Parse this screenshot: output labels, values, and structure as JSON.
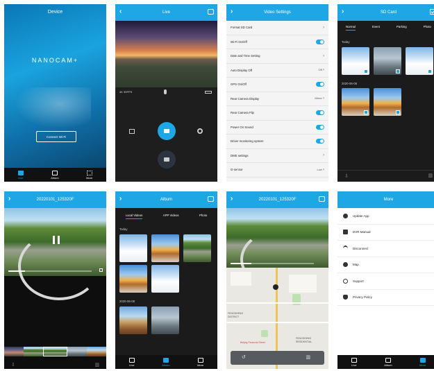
{
  "screens": {
    "device": {
      "title": "Device",
      "logo": "NANOCAM+",
      "connect_button": "Connect Wi-Fi",
      "tabs": [
        "Live",
        "Album",
        "More"
      ]
    },
    "live": {
      "title": "Live",
      "resolution": "4K 30FPS",
      "icons": [
        "back-icon",
        "mic-icon",
        "camera-icon",
        "gallery-icon",
        "video-record-icon",
        "settings-icon",
        "snapshot-icon"
      ]
    },
    "video_settings": {
      "title": "Video Settings",
      "rows": [
        {
          "label": "Format SD Card",
          "kind": "chevron",
          "value": ""
        },
        {
          "label": "Wi-Fi On/Off",
          "kind": "toggle",
          "value": ""
        },
        {
          "label": "Date and Time Setting",
          "kind": "chevron",
          "value": ""
        },
        {
          "label": "Auto Display Off",
          "kind": "value",
          "value": "Off"
        },
        {
          "label": "GPS On/Off",
          "kind": "toggle",
          "value": ""
        },
        {
          "label": "Rear Camera Display",
          "kind": "value",
          "value": "Mirror"
        },
        {
          "label": "Rear Camera Flip",
          "kind": "toggle",
          "value": ""
        },
        {
          "label": "Power On Sound",
          "kind": "toggle",
          "value": ""
        },
        {
          "label": "Driver monitoring system",
          "kind": "toggle",
          "value": ""
        },
        {
          "label": "DMS settings",
          "kind": "chevron",
          "value": ""
        },
        {
          "label": "G-sensor",
          "kind": "value",
          "value": "Low"
        }
      ]
    },
    "sd_card": {
      "title": "SD Card",
      "tabs": [
        "Normal",
        "Event",
        "Parking",
        "Photo"
      ],
      "section_today": "Today",
      "section_date": "2020-06-08"
    },
    "playback": {
      "title": "20220101_125320F"
    },
    "album": {
      "title": "Album",
      "tabs": [
        "Local Videos",
        "APP Videos",
        "Photo"
      ],
      "section_today": "Today",
      "section_date": "2020-06-08",
      "tab_labels": [
        "Live",
        "Album",
        "More"
      ]
    },
    "map_playback": {
      "title": "20220101_125320F",
      "map_labels": [
        "FENGSHENG",
        "DISTRICT",
        "Beijing Financial Street",
        "FENGSHENG",
        "RESIDENTIAL"
      ]
    },
    "more": {
      "title": "More",
      "items": [
        {
          "label": "Update App",
          "icon": "person-icon"
        },
        {
          "label": "DVR Manual",
          "icon": "camera-icon"
        },
        {
          "label": "Disconnect",
          "icon": "wifi-icon"
        },
        {
          "label": "Map",
          "icon": "person-icon"
        },
        {
          "label": "Support",
          "icon": "support-icon"
        },
        {
          "label": "Privacy Policy",
          "icon": "shield-icon"
        }
      ],
      "tabs": [
        "Live",
        "Album",
        "More"
      ]
    }
  },
  "accent_color": "#1ea7e4"
}
